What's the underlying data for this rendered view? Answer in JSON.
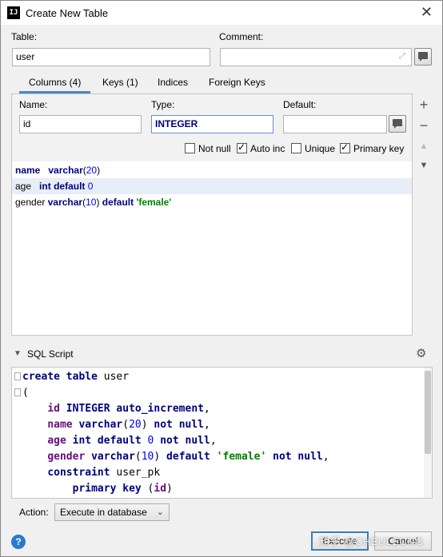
{
  "window": {
    "title": "Create New Table",
    "app_icon_text": "IJ"
  },
  "table_label": "Table:",
  "table_value": "user",
  "comment_label": "Comment:",
  "comment_value": "",
  "tabs": [
    {
      "label": "Columns (4)",
      "active": true
    },
    {
      "label": "Keys (1)",
      "active": false
    },
    {
      "label": "Indices",
      "active": false
    },
    {
      "label": "Foreign Keys",
      "active": false
    }
  ],
  "column_form": {
    "name_label": "Name:",
    "name_value": "id",
    "type_label": "Type:",
    "type_value": "INTEGER",
    "default_label": "Default:",
    "default_value": ""
  },
  "checkboxes": {
    "not_null": {
      "label": "Not null",
      "checked": false
    },
    "auto_inc": {
      "label": "Auto inc",
      "checked": true
    },
    "unique": {
      "label": "Unique",
      "checked": false
    },
    "primary_key": {
      "label": "Primary key",
      "checked": true
    }
  },
  "columns": [
    {
      "name": "name",
      "type": "varchar",
      "size": "20",
      "default_kw": "",
      "default_val": ""
    },
    {
      "name": "age",
      "type": "int",
      "size": "",
      "default_kw": "default",
      "default_val": "0"
    },
    {
      "name": "gender",
      "type": "varchar",
      "size": "10",
      "default_kw": "default",
      "default_val": "'female'"
    }
  ],
  "side_tools": {
    "add": "+",
    "remove": "−",
    "up": "▲",
    "down": "▼"
  },
  "sql": {
    "header": "SQL Script",
    "lines": [
      "create table user",
      "(",
      "    id INTEGER auto_increment,",
      "    name varchar(20) not null,",
      "    age int default 0 not null,",
      "    gender varchar(10) default 'female' not null,",
      "    constraint user_pk",
      "        primary key (id)"
    ]
  },
  "action": {
    "label": "Action:",
    "selected": "Execute in database"
  },
  "buttons": {
    "execute": "Execute",
    "cancel": "Cancel"
  },
  "watermark": "知乎 @CHEULEUNG",
  "colors": {
    "accent": "#4a88c7",
    "keyword": "#000080",
    "string": "#008000",
    "number": "#0000ff"
  }
}
